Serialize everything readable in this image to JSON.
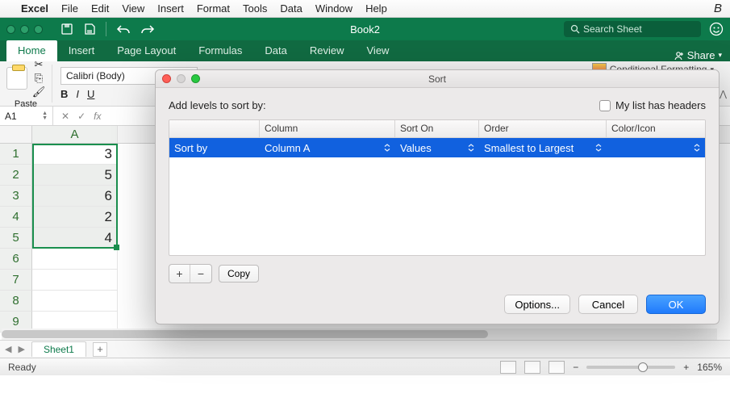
{
  "mac_menu": {
    "app": "Excel",
    "items": [
      "File",
      "Edit",
      "View",
      "Insert",
      "Format",
      "Tools",
      "Data",
      "Window",
      "Help"
    ],
    "right_indicator": "B"
  },
  "titlebar": {
    "doc_title": "Book2",
    "search_placeholder": "Search Sheet"
  },
  "ribbon_tabs": [
    "Home",
    "Insert",
    "Page Layout",
    "Formulas",
    "Data",
    "Review",
    "View"
  ],
  "ribbon_active": "Home",
  "share_label": "Share",
  "ribbon": {
    "paste_label": "Paste",
    "font_name": "Calibri (Body)",
    "conditional_formatting": "Conditional Formatting"
  },
  "namebox": "A1",
  "grid": {
    "col_label": "A",
    "rows": [
      {
        "n": "1",
        "v": "3"
      },
      {
        "n": "2",
        "v": "5"
      },
      {
        "n": "3",
        "v": "6"
      },
      {
        "n": "4",
        "v": "2"
      },
      {
        "n": "5",
        "v": "4"
      },
      {
        "n": "6",
        "v": ""
      },
      {
        "n": "7",
        "v": ""
      },
      {
        "n": "8",
        "v": ""
      },
      {
        "n": "9",
        "v": ""
      }
    ]
  },
  "sheet_tab": "Sheet1",
  "status": {
    "left": "Ready",
    "zoom": "165%"
  },
  "dialog": {
    "title": "Sort",
    "instruction": "Add levels to sort by:",
    "headers_checkbox": "My list has headers",
    "columns": {
      "blank": "",
      "column": "Column",
      "sorton": "Sort On",
      "order": "Order",
      "coloricon": "Color/Icon"
    },
    "row": {
      "label": "Sort by",
      "column": "Column A",
      "sorton": "Values",
      "order": "Smallest to Largest",
      "coloricon": ""
    },
    "copy": "Copy",
    "options": "Options...",
    "cancel": "Cancel",
    "ok": "OK"
  }
}
